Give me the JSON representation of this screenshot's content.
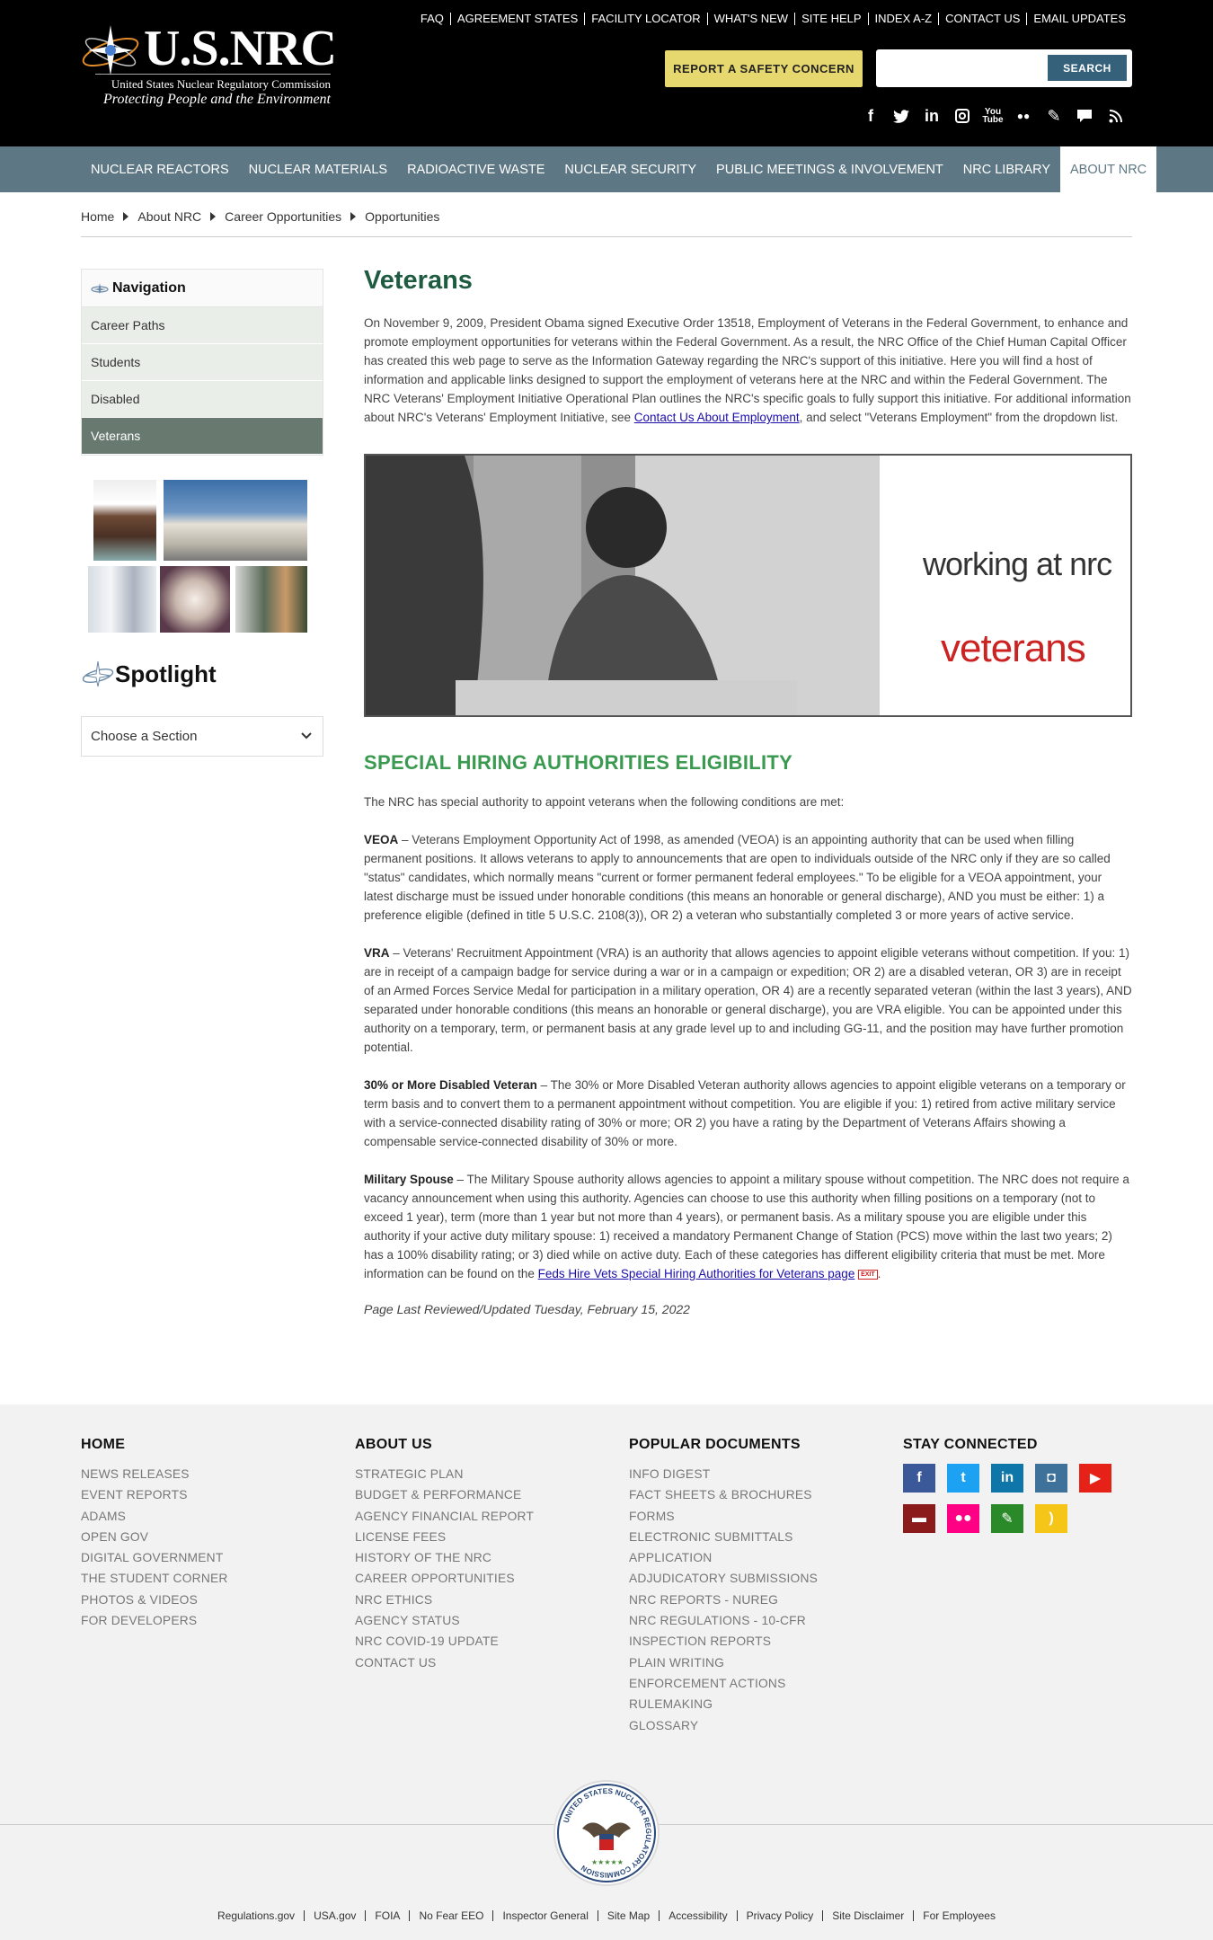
{
  "header": {
    "logo_text": "U.S.NRC",
    "logo_subtitle": "United States Nuclear Regulatory Commission",
    "logo_tagline": "Protecting People and the Environment",
    "utility_links": [
      "FAQ",
      "AGREEMENT STATES",
      "FACILITY LOCATOR",
      "WHAT'S NEW",
      "SITE HELP",
      "INDEX A-Z",
      "CONTACT US",
      "EMAIL UPDATES"
    ],
    "report_button": "REPORT A SAFETY CONCERN",
    "search": {
      "placeholder": "",
      "button": "SEARCH"
    },
    "social_icons": [
      "facebook-icon",
      "twitter-icon",
      "linkedin-icon",
      "instagram-icon",
      "youtube-icon",
      "flickr-icon",
      "blog-icon",
      "chat-icon",
      "rss-icon"
    ]
  },
  "nav": {
    "items": [
      "NUCLEAR REACTORS",
      "NUCLEAR MATERIALS",
      "RADIOACTIVE WASTE",
      "NUCLEAR SECURITY",
      "PUBLIC MEETINGS & INVOLVEMENT",
      "NRC LIBRARY",
      "ABOUT NRC"
    ],
    "active": "ABOUT NRC"
  },
  "breadcrumb": [
    "Home",
    "About NRC",
    "Career Opportunities",
    "Opportunities"
  ],
  "sidebar": {
    "heading": "Navigation",
    "items": [
      "Career Paths",
      "Students",
      "Disabled",
      "Veterans"
    ],
    "active": "Veterans",
    "spotlight_title": "Spotlight",
    "spotlight_select": "Choose a Section"
  },
  "main": {
    "title": "Veterans",
    "intro_before_link": "On November 9, 2009, President Obama signed Executive Order 13518, Employment of Veterans in the Federal Government, to enhance and promote employment opportunities for veterans within the Federal Government. As a result, the NRC Office of the Chief Human Capital Officer has created this web page to serve as the Information Gateway regarding the NRC's support of this initiative. Here you will find a host of information and applicable links designed to support the employment of veterans here at the NRC and within the Federal Government. The NRC Veterans' Employment Initiative Operational Plan outlines the NRC's specific goals to fully support this initiative. For additional information about NRC's Veterans' Employment Initiative, see ",
    "intro_link": "Contact Us About Employment",
    "intro_after_link": ", and select \"Veterans Employment\" from the dropdown list.",
    "banner": {
      "line1": "working at nrc",
      "line2": "veterans"
    },
    "section_title": "SPECIAL HIRING AUTHORITIES ELIGIBILITY",
    "section_intro": "The NRC has special authority to appoint veterans when the following conditions are met:",
    "authorities": [
      {
        "term": "VEOA",
        "text": " – Veterans Employment Opportunity Act of 1998, as amended (VEOA) is an appointing authority that can be used when filling permanent positions. It allows veterans to apply to announcements that are open to individuals outside of the NRC only if they are so called \"status\" candidates, which normally means \"current or former permanent federal employees.\" To be eligible for a VEOA appointment, your latest discharge must be issued under honorable conditions (this means an honorable or general discharge), AND you must be either: 1) a preference eligible (defined in title 5 U.S.C. 2108(3)), OR 2) a veteran who substantially completed 3 or more years of active service."
      },
      {
        "term": "VRA",
        "text": " – Veterans' Recruitment Appointment (VRA) is an authority that allows agencies to appoint eligible veterans without competition. If you: 1) are in receipt of a campaign badge for service during a war or in a campaign or expedition; OR 2) are a disabled veteran, OR 3) are in receipt of an Armed Forces Service Medal for participation in a military operation, OR 4) are a recently separated veteran (within the last 3 years), AND separated under honorable conditions (this means an honorable or general discharge), you are VRA eligible. You can be appointed under this authority on a temporary, term, or permanent basis at any grade level up to and including GG-11, and the position may have further promotion potential."
      },
      {
        "term": "30% or More Disabled Veteran",
        "text": " – The 30% or More Disabled Veteran authority allows agencies to appoint eligible veterans on a temporary or term basis and to convert them to a permanent appointment without competition. You are eligible if you: 1) retired from active military service with a service-connected disability rating of 30% or more; OR 2) you have a rating by the Department of Veterans Affairs showing a compensable service-connected disability of 30% or more."
      },
      {
        "term": "Military Spouse",
        "text": " – The Military Spouse authority allows agencies to appoint a military spouse without competition. The NRC does not require a vacancy announcement when using this authority. Agencies can choose to use this authority when filling positions on a temporary (not to exceed 1 year), term (more than 1 year but not more than 4 years), or permanent basis. As a military spouse you are eligible under this authority if your active duty military spouse: 1) received a mandatory Permanent Change of Station (PCS) move within the last two years; 2) has a 100% disability rating; or 3) died while on active duty. Each of these categories has different eligibility criteria that must be met. More information can be found on the ",
        "link": "Feds Hire Vets Special Hiring Authorities for Veterans page",
        "exit": "EXIT",
        "after": "."
      }
    ],
    "reviewed": "Page Last Reviewed/Updated Tuesday, February 15, 2022"
  },
  "footer": {
    "columns": [
      {
        "title": "HOME",
        "links": [
          "NEWS RELEASES",
          "EVENT REPORTS",
          "ADAMS",
          "OPEN GOV",
          "DIGITAL GOVERNMENT",
          "THE STUDENT CORNER",
          "PHOTOS & VIDEOS",
          "FOR DEVELOPERS"
        ]
      },
      {
        "title": "ABOUT US",
        "links": [
          "STRATEGIC PLAN",
          "BUDGET & PERFORMANCE",
          "AGENCY FINANCIAL REPORT",
          "LICENSE FEES",
          "HISTORY OF THE NRC",
          "CAREER OPPORTUNITIES",
          "NRC ETHICS",
          "AGENCY STATUS",
          "NRC COVID-19 UPDATE",
          "CONTACT US"
        ]
      },
      {
        "title": "POPULAR DOCUMENTS",
        "links": [
          "INFO DIGEST",
          "FACT SHEETS & BROCHURES",
          "FORMS",
          "ELECTRONIC SUBMITTALS",
          "APPLICATION",
          "ADJUDICATORY SUBMISSIONS",
          "NRC REPORTS - NUREG",
          "NRC REGULATIONS - 10-CFR",
          "INSPECTION REPORTS",
          "PLAIN WRITING",
          "ENFORCEMENT ACTIONS",
          "RULEMAKING",
          "GLOSSARY"
        ]
      },
      {
        "title": "STAY CONNECTED",
        "links": []
      }
    ],
    "social": [
      {
        "icon": "facebook-icon",
        "color": "#3b5998",
        "glyph": "f"
      },
      {
        "icon": "twitter-icon",
        "color": "#1da1f2",
        "glyph": "t"
      },
      {
        "icon": "linkedin-icon",
        "color": "#0e76a8",
        "glyph": "in"
      },
      {
        "icon": "instagram-icon",
        "color": "#3f729b",
        "glyph": "◘"
      },
      {
        "icon": "youtube-icon",
        "color": "#e62117",
        "glyph": "▶"
      },
      {
        "icon": "chat-icon",
        "color": "#8b1a1a",
        "glyph": "▬"
      },
      {
        "icon": "flickr-icon",
        "color": "#ff0084",
        "glyph": "●●"
      },
      {
        "icon": "blog-icon",
        "color": "#2a8a2a",
        "glyph": "✎"
      },
      {
        "icon": "rss-icon",
        "color": "#f5c518",
        "glyph": ")"
      }
    ],
    "seal_text": "UNITED STATES NUCLEAR REGULATORY COMMISSION",
    "bottom_links": [
      "Regulations.gov",
      "USA.gov",
      "FOIA",
      "No Fear EEO",
      "Inspector General",
      "Site Map",
      "Accessibility",
      "Privacy Policy",
      "Site Disclaimer",
      "For Employees"
    ]
  }
}
